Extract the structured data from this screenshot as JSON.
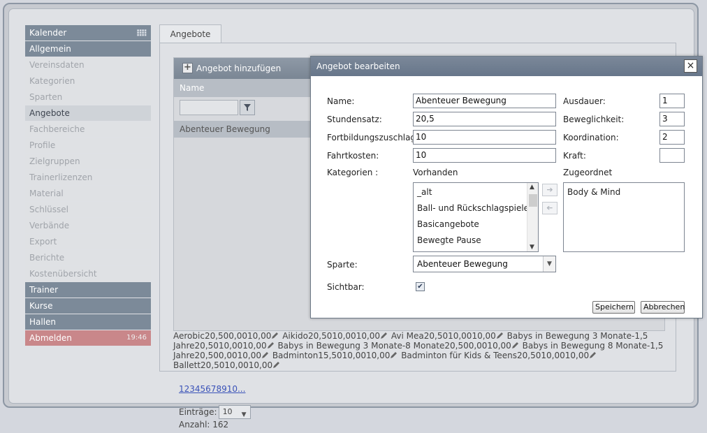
{
  "sidebar": {
    "items": [
      {
        "label": "Kalender",
        "type": "header",
        "icon": "calendar-icon"
      },
      {
        "label": "Allgemein",
        "type": "header"
      },
      {
        "label": "Vereinsdaten",
        "type": "sub"
      },
      {
        "label": "Kategorien",
        "type": "sub"
      },
      {
        "label": "Sparten",
        "type": "sub"
      },
      {
        "label": "Angebote",
        "type": "active"
      },
      {
        "label": "Fachbereiche",
        "type": "sub"
      },
      {
        "label": "Profile",
        "type": "sub"
      },
      {
        "label": "Zielgruppen",
        "type": "sub"
      },
      {
        "label": "Trainerlizenzen",
        "type": "sub"
      },
      {
        "label": "Material",
        "type": "sub"
      },
      {
        "label": "Schlüssel",
        "type": "sub"
      },
      {
        "label": "Verbände",
        "type": "sub"
      },
      {
        "label": "Export",
        "type": "sub"
      },
      {
        "label": "Berichte",
        "type": "sub"
      },
      {
        "label": "Kostenübersicht",
        "type": "sub"
      },
      {
        "label": "Trainer",
        "type": "header"
      },
      {
        "label": "Kurse",
        "type": "header"
      },
      {
        "label": "Hallen",
        "type": "header"
      },
      {
        "label": "Abmelden",
        "type": "logout",
        "time": "19:46"
      }
    ]
  },
  "tab": {
    "label": "Angebote"
  },
  "grid": {
    "add_label": "Angebot hinzufügen",
    "column_name": "Name",
    "rows": [
      "Abenteuer Bewegung"
    ]
  },
  "data_text": [
    "Aerobic20,500,0010,00",
    "Aikido20,5010,0010,00",
    "Avi Mea20,5010,0010,00",
    "Babys in Bewegung 3 Monate-1,5 Jahre20,5010,0010,00",
    "Babys in Bewegung 3 Monate-8 Monate20,500,0010,00",
    "Babys in Bewegung 8 Monate-1,5 Jahre20,500,0010,00",
    "Badminton15,5010,0010,00",
    "Badminton für Kids & Teens20,5010,0010,00",
    "Ballett20,5010,0010,00"
  ],
  "pager": {
    "pages_link": "12345678910...",
    "entries_label": "Einträge:",
    "entries_value": "10",
    "count_label": "Anzahl: 162"
  },
  "dialog": {
    "title": "Angebot bearbeiten",
    "close_symbol": "×",
    "fields_left": [
      {
        "label": "Name:",
        "value": "Abenteuer Bewegung"
      },
      {
        "label": "Stundensatz:",
        "value": "20,5"
      },
      {
        "label": "Fortbildungszuschlag:",
        "value": "10"
      },
      {
        "label": "Fahrtkosten:",
        "value": "10"
      }
    ],
    "fields_right": [
      {
        "label": "Ausdauer:",
        "value": "1"
      },
      {
        "label": "Beweglichkeit:",
        "value": "3"
      },
      {
        "label": "Koordination:",
        "value": "2"
      },
      {
        "label": "Kraft:",
        "value": ""
      }
    ],
    "categories_label": "Kategorien :",
    "available_label": "Vorhanden",
    "assigned_label": "Zugeordnet",
    "available_items": [
      "_alt",
      "Ball- und Rückschlagspiele",
      "Basicangebote",
      "Bewegte Pause"
    ],
    "assigned_items": [
      "Body & Mind"
    ],
    "sparte_label": "Sparte:",
    "sparte_value": "Abenteuer Bewegung",
    "visible_label": "Sichtbar:",
    "visible_checked": true,
    "save_label": "Speichern",
    "cancel_label": "Abbrechen"
  }
}
